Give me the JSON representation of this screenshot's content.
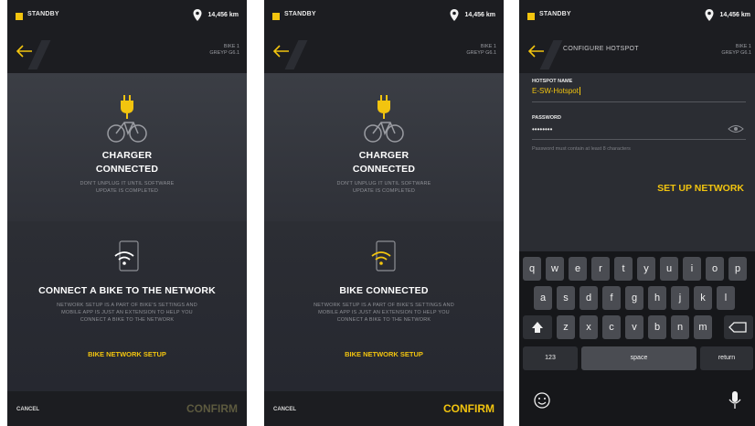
{
  "screens": [
    {
      "status": {
        "mode": "STANDBY",
        "odometer": "14,456 km"
      },
      "header": {
        "bike_name": "BIKE 1",
        "bike_model": "GREYP G6.1"
      },
      "charger": {
        "title_line1": "CHARGER",
        "title_line2": "CONNECTED",
        "note_line1": "DON'T UNPLUG IT UNTIL SOFTWARE",
        "note_line2": "UPDATE IS COMPLETED"
      },
      "network": {
        "title": "CONNECT A BIKE TO THE NETWORK",
        "desc_line1": "NETWORK SETUP IS A PART OF BIKE'S SETTINGS AND",
        "desc_line2": "MOBILE APP IS JUST AN EXTENSION TO HELP YOU",
        "desc_line3": "CONNECT A BIKE TO THE NETWORK",
        "link": "BIKE NETWORK SETUP"
      },
      "footer": {
        "cancel": "CANCEL",
        "confirm": "CONFIRM"
      }
    },
    {
      "status": {
        "mode": "STANDBY",
        "odometer": "14,456 km"
      },
      "header": {
        "bike_name": "BIKE 1",
        "bike_model": "GREYP G6.1"
      },
      "charger": {
        "title_line1": "CHARGER",
        "title_line2": "CONNECTED",
        "note_line1": "DON'T UNPLUG IT UNTIL SOFTWARE",
        "note_line2": "UPDATE IS COMPLETED"
      },
      "network": {
        "title": "BIKE CONNECTED",
        "desc_line1": "NETWORK SETUP IS A PART OF BIKE'S SETTINGS AND",
        "desc_line2": "MOBILE APP IS JUST AN EXTENSION TO HELP YOU",
        "desc_line3": "CONNECT A BIKE TO THE NETWORK",
        "link": "BIKE NETWORK SETUP"
      },
      "footer": {
        "cancel": "CANCEL",
        "confirm": "CONFIRM"
      }
    },
    {
      "status": {
        "mode": "STANDBY",
        "odometer": "14,456 km"
      },
      "header": {
        "title": "CONFIGURE HOTSPOT",
        "bike_name": "BIKE 1",
        "bike_model": "GREYP G6.1"
      },
      "form": {
        "name_label": "HOTSPOT NAME",
        "name_value": "E-SW-Hotspot",
        "password_label": "PASSWORD",
        "password_value": "••••••••",
        "hint": "Password must contain at least 8 characters",
        "setup_button": "SET UP NETWORK"
      },
      "keyboard": {
        "row1": [
          "q",
          "w",
          "e",
          "r",
          "t",
          "y",
          "u",
          "i",
          "o",
          "p"
        ],
        "row2": [
          "a",
          "s",
          "d",
          "f",
          "g",
          "h",
          "j",
          "k",
          "l"
        ],
        "row3": [
          "z",
          "x",
          "c",
          "v",
          "b",
          "n",
          "m"
        ],
        "numbers": "123",
        "space": "space",
        "return": "return"
      }
    }
  ],
  "colors": {
    "accent": "#f2c40f",
    "background": "#2b2d33",
    "bar": "#1c1d21"
  }
}
